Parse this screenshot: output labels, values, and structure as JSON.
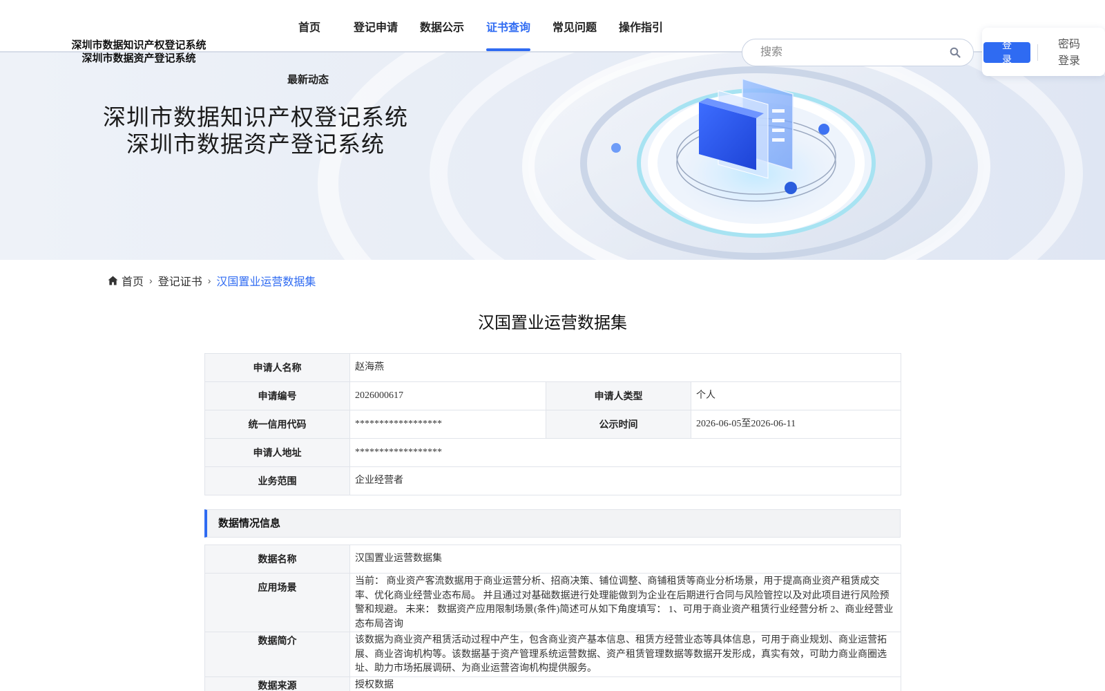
{
  "header": {
    "logo_line1": "深圳市数据知识产权登记系统",
    "logo_line2": "深圳市数据资产登记系统",
    "nav": [
      {
        "label": "首页",
        "active": false
      },
      {
        "label": "登记申请",
        "active": false
      },
      {
        "label": "数据公示",
        "active": false
      },
      {
        "label": "证书查询",
        "active": true
      },
      {
        "label": "常见问题",
        "active": false
      },
      {
        "label": "操作指引",
        "active": false
      }
    ],
    "nav_sub": "最新动态",
    "search_placeholder": "搜索",
    "login_label": "登录",
    "password_login_label": "密码登录"
  },
  "banner": {
    "title_line1": "深圳市数据知识产权登记系统",
    "title_line2": "深圳市数据资产登记系统"
  },
  "breadcrumb": [
    {
      "label": "首页"
    },
    {
      "label": "登记证书"
    },
    {
      "label": "汉国置业运营数据集"
    }
  ],
  "page_title": "汉国置业运营数据集",
  "applicant": {
    "name_label": "申请人名称",
    "name": "赵海燕",
    "number_label": "申请编号",
    "number": "2026000617",
    "type_label": "申请人类型",
    "type": "个人",
    "credit_code_label": "统一信用代码",
    "credit_code": "******************",
    "publicity_label": "公示时间",
    "publicity": "2026-06-05至2026-06-11",
    "address_label": "申请人地址",
    "address": "******************",
    "business_label": "业务范围",
    "business": "企业经营者"
  },
  "data_section": {
    "title": "数据情况信息",
    "name_label": "数据名称",
    "name": "汉国置业运营数据集",
    "scenario_label": "应用场景",
    "scenario": "当前： 商业资产客流数据用于商业运营分析、招商决策、铺位调整、商铺租赁等商业分析场景，用于提高商业资产租赁成交率、优化商业经营业态布局。 并且通过对基础数据进行处理能做到为企业在后期进行合同与风险管控以及对此项目进行风险预警和规避。 未来： 数据资产应用限制场景(条件)简述可从如下角度填写： 1、可用于商业资产租赁行业经营分析 2、商业经营业态布局咨询",
    "intro_label": "数据简介",
    "intro": "该数据为商业资产租赁活动过程中产生，包含商业资产基本信息、租赁方经营业态等具体信息，可用于商业规划、商业运营拓展、商业咨询机构等。该数据基于资产管理系统运营数据、资产租赁管理数据等数据开发形成，真实有效，可助力商业商圈选址、助力市场拓展调研、为商业运营咨询机构提供服务。",
    "source_label": "数据来源",
    "source": "授权数据"
  },
  "colors": {
    "accent": "#2f6bf2",
    "label_bg": "#f5f6f8",
    "border": "#e1e4ea"
  }
}
